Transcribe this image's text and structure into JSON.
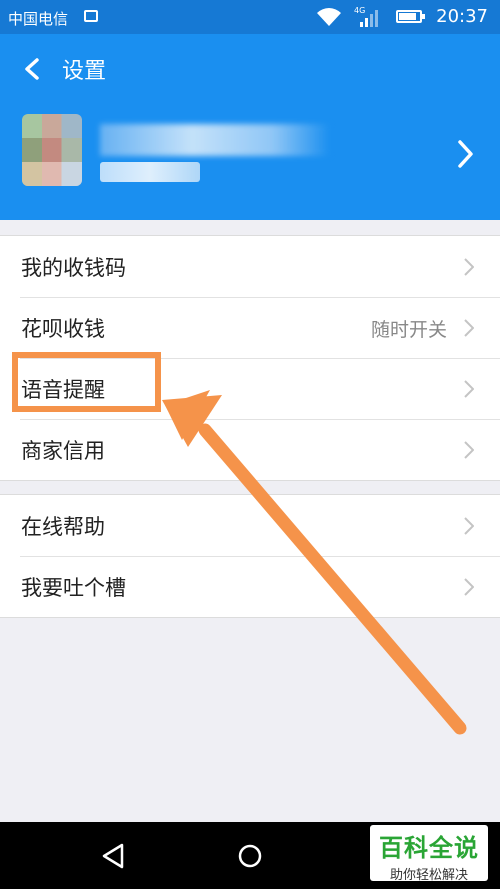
{
  "status_bar": {
    "carrier": "中国电信",
    "network": "4G",
    "time": "20:37"
  },
  "header": {
    "back_icon": "chevron-left-icon",
    "title": "设置",
    "profile_chevron_icon": "chevron-right-icon"
  },
  "menu": {
    "group1": [
      {
        "label": "我的收钱码",
        "value": ""
      },
      {
        "label": "花呗收钱",
        "value": "随时开关"
      },
      {
        "label": "语音提醒",
        "value": ""
      },
      {
        "label": "商家信用",
        "value": ""
      }
    ],
    "group2": [
      {
        "label": "在线帮助",
        "value": ""
      },
      {
        "label": "我要吐个槽",
        "value": ""
      }
    ]
  },
  "annotation": {
    "color": "#f5934a",
    "target": "语音提醒"
  },
  "watermark": {
    "title": "百科全说",
    "subtitle": "助你轻松解决"
  },
  "colors": {
    "header_bg": "#1a8ff0",
    "status_bg": "#1679d4",
    "page_bg": "#efeff4"
  }
}
